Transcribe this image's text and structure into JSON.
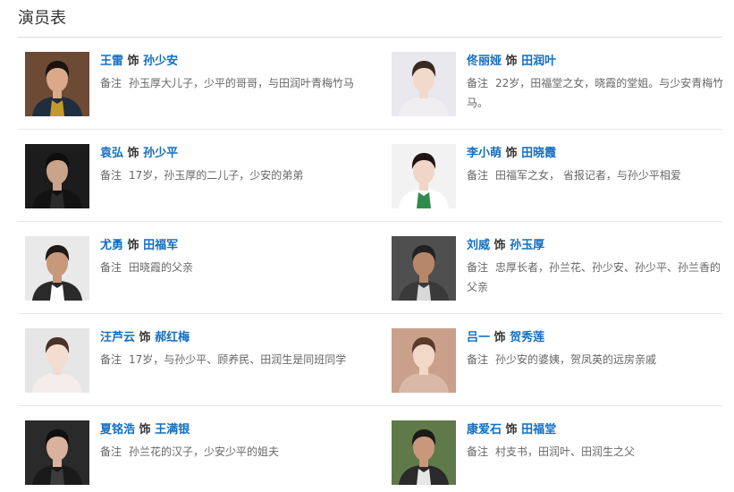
{
  "page": {
    "title": "演员表"
  },
  "cast": [
    {
      "actor": "王雷",
      "shi": "饰",
      "role": "孙少安",
      "note_label": "备注",
      "note": "孙玉厚大儿子，少平的哥哥，与田润叶青梅竹马",
      "photo_bg": "#6d4a33",
      "shirt": "#c49a2c",
      "jacket": "#1f2d3f",
      "hair": "#1a1310",
      "skin": "#d9a98a"
    },
    {
      "actor": "佟丽娅",
      "shi": "饰",
      "role": "田润叶",
      "note_label": "备注",
      "note": "22岁，田福堂之女，晓霞的堂姐。与少安青梅竹马。",
      "photo_bg": "#e8e8ee",
      "shirt": "#f1eef2",
      "jacket": "#f1eef2",
      "hair": "#3a2a22",
      "skin": "#f1d9cc"
    },
    {
      "actor": "袁弘",
      "shi": "饰",
      "role": "孙少平",
      "note_label": "备注",
      "note": "17岁，孙玉厚的二儿子，少安的弟弟",
      "photo_bg": "#1c1c1c",
      "shirt": "#2b2b2b",
      "jacket": "#121212",
      "hair": "#0d0d0d",
      "skin": "#c9a38a"
    },
    {
      "actor": "李小萌",
      "shi": "饰",
      "role": "田晓霞",
      "note_label": "备注",
      "note": "田福军之女，  省报记者，与孙少平相爱",
      "photo_bg": "#f2f2f2",
      "shirt": "#2f8a4e",
      "jacket": "#ffffff",
      "hair": "#1e1612",
      "skin": "#f0d6c8"
    },
    {
      "actor": "尤勇",
      "shi": "饰",
      "role": "田福军",
      "note_label": "备注",
      "note": "田晓霞的父亲",
      "photo_bg": "#e9e9e9",
      "shirt": "#ffffff",
      "jacket": "#2a2a2a",
      "hair": "#1d1a18",
      "skin": "#c8987a"
    },
    {
      "actor": "刘威",
      "shi": "饰",
      "role": "孙玉厚",
      "note_label": "备注",
      "note": "忠厚长者，孙兰花、孙少安、孙少平、孙兰香的父亲",
      "photo_bg": "#4f4f4f",
      "shirt": "#d8d8d8",
      "jacket": "#3a3a3a",
      "hair": "#222222",
      "skin": "#b8876a"
    },
    {
      "actor": "汪芦云",
      "shi": "饰",
      "role": "郝红梅",
      "note_label": "备注",
      "note": "17岁，与孙少平、顾养民、田润生是同班同学",
      "photo_bg": "#e6e6e6",
      "shirt": "#f5ecec",
      "jacket": "#f5ecec",
      "hair": "#4a3226",
      "skin": "#f3dcd0"
    },
    {
      "actor": "吕一",
      "shi": "饰",
      "role": "贺秀莲",
      "note_label": "备注",
      "note": "孙少安的婆姨，贺凤英的远房亲戚",
      "photo_bg": "#c9a08a",
      "shirt": "#d9b8a8",
      "jacket": "#d9b8a8",
      "hair": "#5b3a2a",
      "skin": "#f2d8c6"
    },
    {
      "actor": "夏铭浩",
      "shi": "饰",
      "role": "王满银",
      "note_label": "备注",
      "note": "孙兰花的汉子，少安少平的姐夫",
      "photo_bg": "#2a2a2a",
      "shirt": "#3c3c3c",
      "jacket": "#1a1a1a",
      "hair": "#0f0f0f",
      "skin": "#d8b29a"
    },
    {
      "actor": "康爱石",
      "shi": "饰",
      "role": "田福堂",
      "note_label": "备注",
      "note": "村支书，田润叶、田润生之父",
      "photo_bg": "#5f7a48",
      "shirt": "#e6e6e6",
      "jacket": "#2a2a2a",
      "hair": "#1a1a1a",
      "skin": "#c9987a"
    }
  ]
}
